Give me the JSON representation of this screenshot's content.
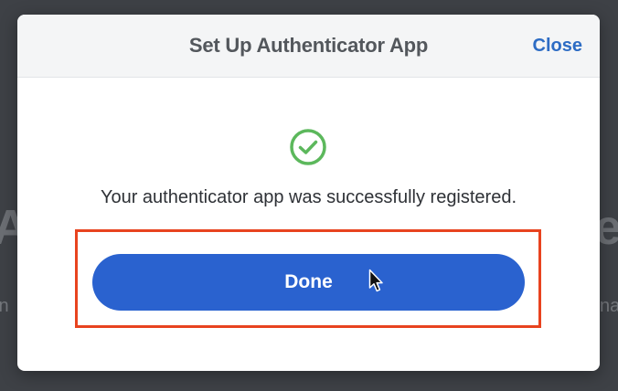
{
  "background": {
    "left_big": "A",
    "right_big": "e",
    "left_small": "in",
    "right_small": "na"
  },
  "dialog": {
    "title": "Set Up Authenticator App",
    "close_label": "Close",
    "icon": "check-circle-icon",
    "message": "Your authenticator app was successfully registered.",
    "done_label": "Done"
  },
  "colors": {
    "accent": "#2a62cf",
    "link": "#2d6cc4",
    "success": "#5cb85c",
    "highlight": "#e8431f"
  }
}
